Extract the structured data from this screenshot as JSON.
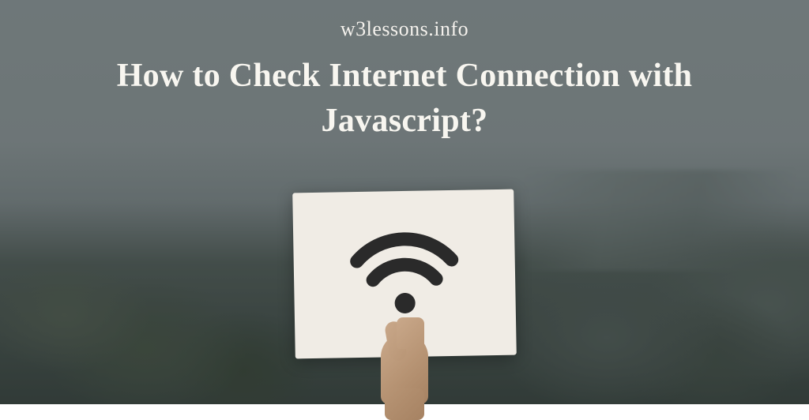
{
  "site_name": "w3lessons.info",
  "title": "How  to Check Internet Connection with Javascript?",
  "icon_name": "wifi-icon",
  "colors": {
    "text": "#f8f6f0",
    "card_bg": "#f0ece5",
    "wifi_icon": "#2a2a2a"
  }
}
